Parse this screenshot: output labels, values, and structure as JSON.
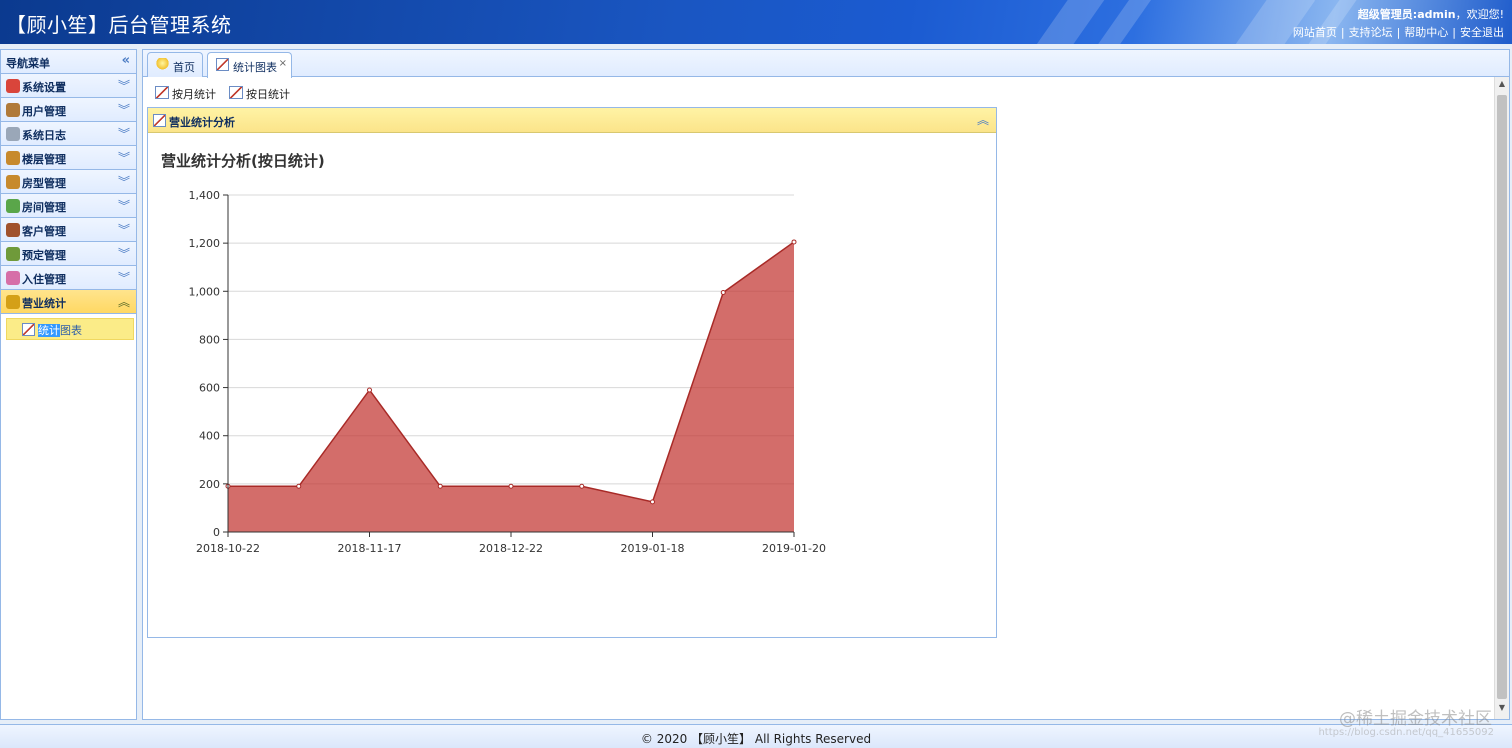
{
  "header": {
    "title": "【顾小笙】后台管理系统",
    "welcome_prefix": "超级管理员:",
    "welcome_user": "admin",
    "welcome_suffix": "，欢迎您!",
    "links": [
      "网站首页",
      "支持论坛",
      "帮助中心",
      "安全退出"
    ],
    "separator": "|"
  },
  "sidebar": {
    "title": "导航菜单",
    "collapse_icon": "double-chevron-left-icon",
    "items": [
      {
        "label": "系统设置",
        "icon": "tools-icon",
        "color": "#d9453b"
      },
      {
        "label": "用户管理",
        "icon": "user-icon",
        "color": "#b07a3a"
      },
      {
        "label": "系统日志",
        "icon": "document-icon",
        "color": "#9aa7b8"
      },
      {
        "label": "楼层管理",
        "icon": "house-icon",
        "color": "#c78a2d"
      },
      {
        "label": "房型管理",
        "icon": "house-icon",
        "color": "#c78a2d"
      },
      {
        "label": "房间管理",
        "icon": "house-icon",
        "color": "#5aa64a"
      },
      {
        "label": "客户管理",
        "icon": "users-icon",
        "color": "#a0522d"
      },
      {
        "label": "预定管理",
        "icon": "clock-icon",
        "color": "#6f9a3a"
      },
      {
        "label": "入住管理",
        "icon": "chat-icon",
        "color": "#d66fa8"
      },
      {
        "label": "营业统计",
        "icon": "money-icon",
        "color": "#d4a017",
        "active": true
      }
    ],
    "sub_item": {
      "label_highlight": "统计",
      "label_rest": "图表"
    }
  },
  "tabs": [
    {
      "label": "首页",
      "icon": "lightbulb-icon",
      "active": false
    },
    {
      "label": "统计图表",
      "icon": "chart-icon",
      "active": true,
      "close": "×"
    }
  ],
  "toolbar": {
    "buttons": [
      {
        "label": "按月统计",
        "icon": "chart-icon"
      },
      {
        "label": "按日统计",
        "icon": "chart-icon"
      }
    ]
  },
  "panel": {
    "title": "营业统计分析",
    "collapse_icon": "double-chevron-up-icon"
  },
  "chart_data": {
    "type": "area",
    "title": "营业统计分析(按日统计)",
    "xlabel": "",
    "ylabel": "",
    "ylim": [
      0,
      1400
    ],
    "yticks": [
      0,
      200,
      400,
      600,
      800,
      1000,
      1200,
      1400
    ],
    "ytick_labels": [
      "0",
      "200",
      "400",
      "600",
      "800",
      "1,000",
      "1,200",
      "1,400"
    ],
    "xtick_labels": [
      "2018-10-22",
      "2018-11-17",
      "2018-12-22",
      "2019-01-18",
      "2019-01-20"
    ],
    "values": [
      190,
      190,
      590,
      190,
      190,
      190,
      125,
      995,
      1205
    ],
    "grid": true,
    "color": "#c23531"
  },
  "footer": {
    "text": "© 2020 【顾小笙】 All Rights Reserved"
  },
  "watermark": {
    "text": "@稀土掘金技术社区",
    "small": "https://blog.csdn.net/qq_41655092"
  }
}
